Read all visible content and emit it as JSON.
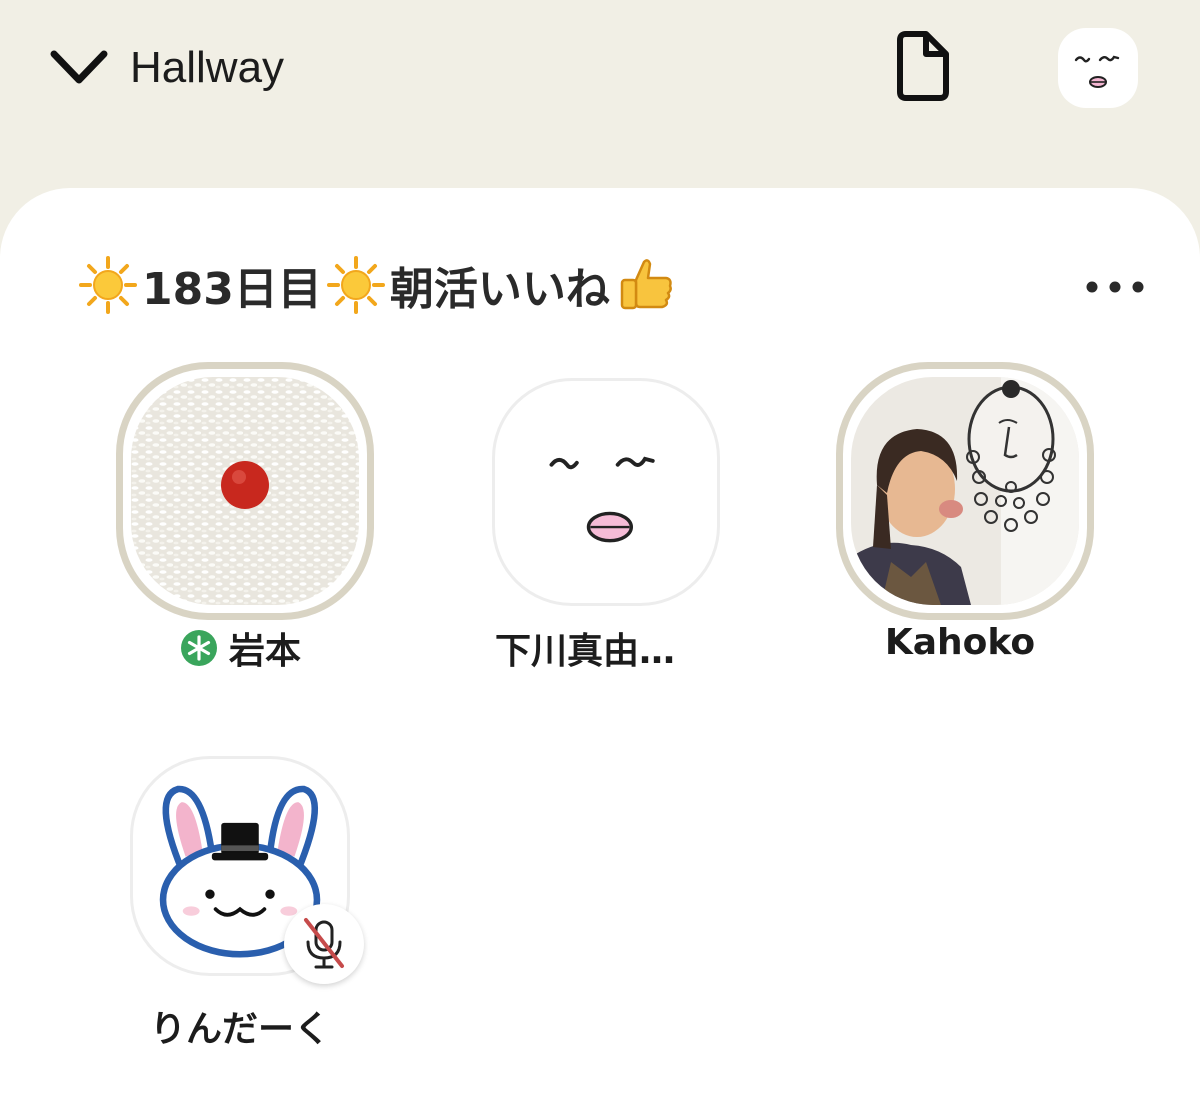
{
  "header": {
    "back_icon": "chevron-down-icon",
    "title": "Hallway",
    "document_icon": "document-icon",
    "profile_icon": "avatar-face-icon"
  },
  "room": {
    "title_parts": [
      "183日目",
      "朝活いいね"
    ],
    "title_icons": [
      "sun-emoji",
      "sun-emoji",
      "thumbs-up-emoji"
    ],
    "more_icon": "ellipsis-icon"
  },
  "members": [
    {
      "name": "岩本",
      "badge": "new-member-icon",
      "speaking": true
    },
    {
      "name": "下川真由…",
      "speaking": false
    },
    {
      "name": "Kahoko",
      "speaking": true
    },
    {
      "name": "りんだーく",
      "speaking": false,
      "muted": true,
      "badge": "mic-muted-icon"
    }
  ],
  "colors": {
    "background": "#f1efe5",
    "card": "#ffffff",
    "speaking_ring": "#d9d4c4",
    "new_badge": "#3aa55c",
    "mute_slash": "#c64b4b"
  }
}
